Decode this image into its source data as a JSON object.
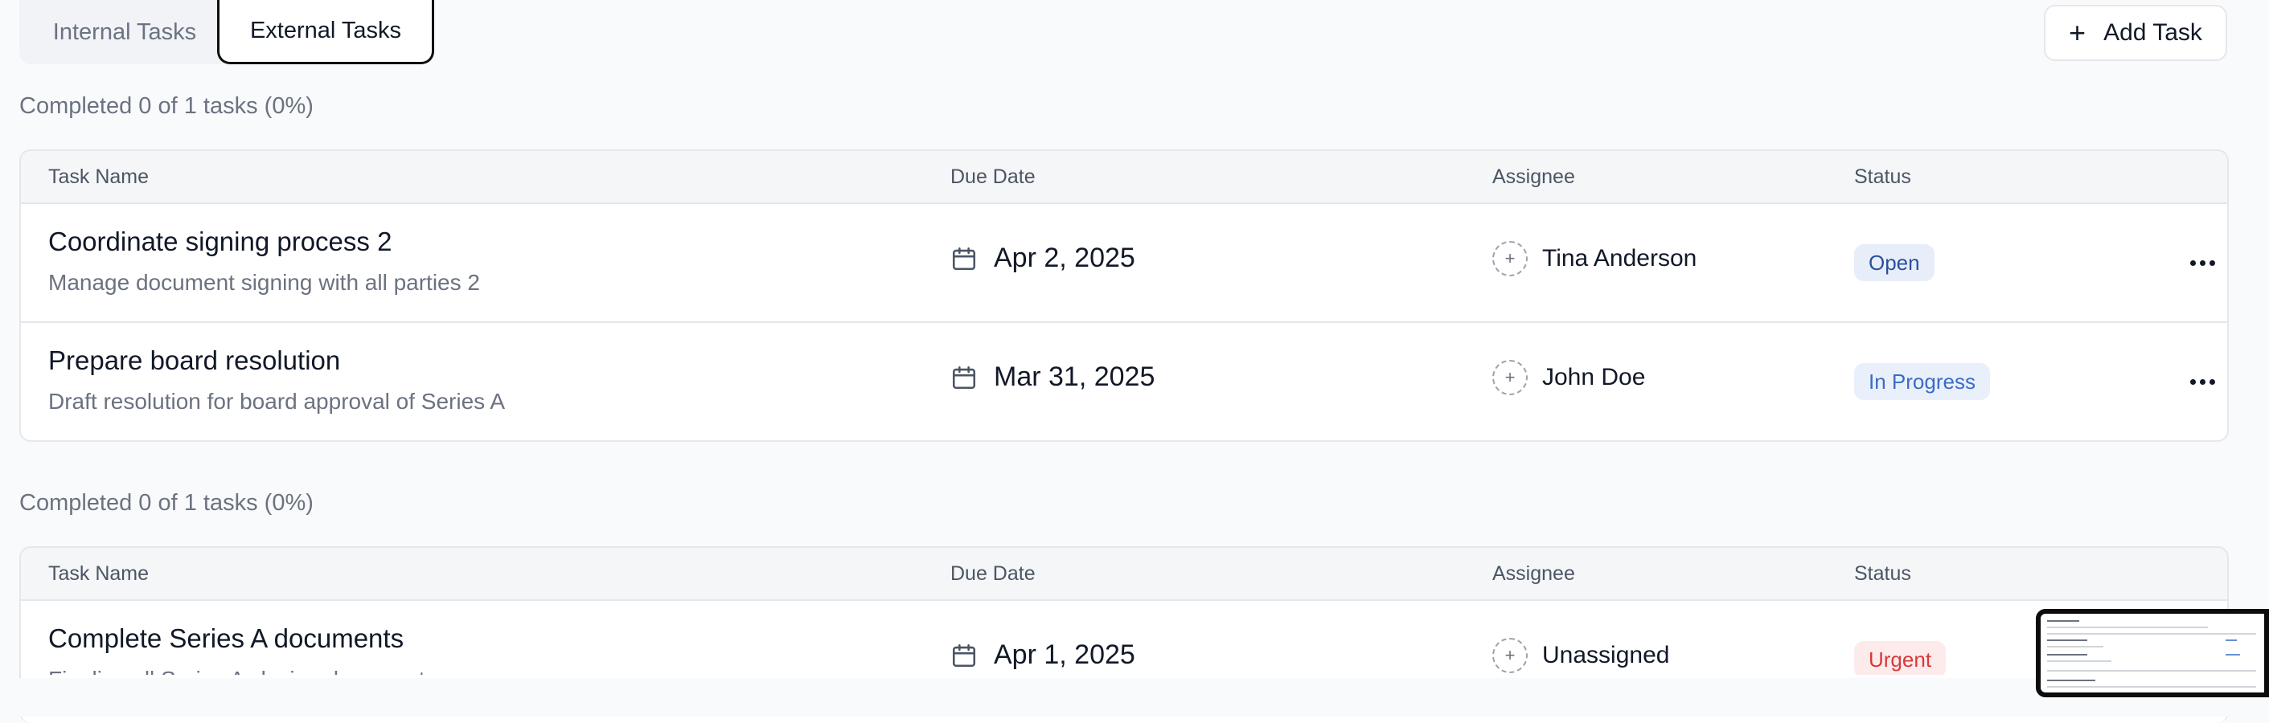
{
  "tabs": {
    "internal": "Internal Tasks",
    "external": "External Tasks"
  },
  "add_task": {
    "icon": "plus-icon",
    "label": "Add Task"
  },
  "columns": {
    "name": "Task Name",
    "due": "Due Date",
    "assignee": "Assignee",
    "status": "Status"
  },
  "sections": [
    {
      "summary": "Completed 0 of 1 tasks (0%)",
      "tasks": [
        {
          "title": "Coordinate signing process 2",
          "desc": "Manage document signing with all parties 2",
          "due": "Apr 2, 2025",
          "assignee": "Tina Anderson",
          "status": "Open"
        },
        {
          "title": "Prepare board resolution",
          "desc": "Draft resolution for board approval of Series A",
          "due": "Mar 31, 2025",
          "assignee": "John Doe",
          "status": "In Progress"
        }
      ]
    },
    {
      "summary": "Completed 0 of 1 tasks (0%)",
      "tasks": [
        {
          "title": "Complete Series A documents",
          "desc": "Finalize all Series A closing documents",
          "due": "Apr 1, 2025",
          "assignee": "Unassigned",
          "status": "Urgent"
        }
      ]
    }
  ],
  "icons": {
    "calendar": "calendar-icon",
    "avatar_add": "add-assignee-icon",
    "more": "more-horizontal-icon"
  },
  "colors": {
    "open_badge": "#2a4f9e",
    "in_progress_badge": "#3b6cc4",
    "urgent_badge": "#d63a3a",
    "page_bg": "#f9fafb"
  }
}
